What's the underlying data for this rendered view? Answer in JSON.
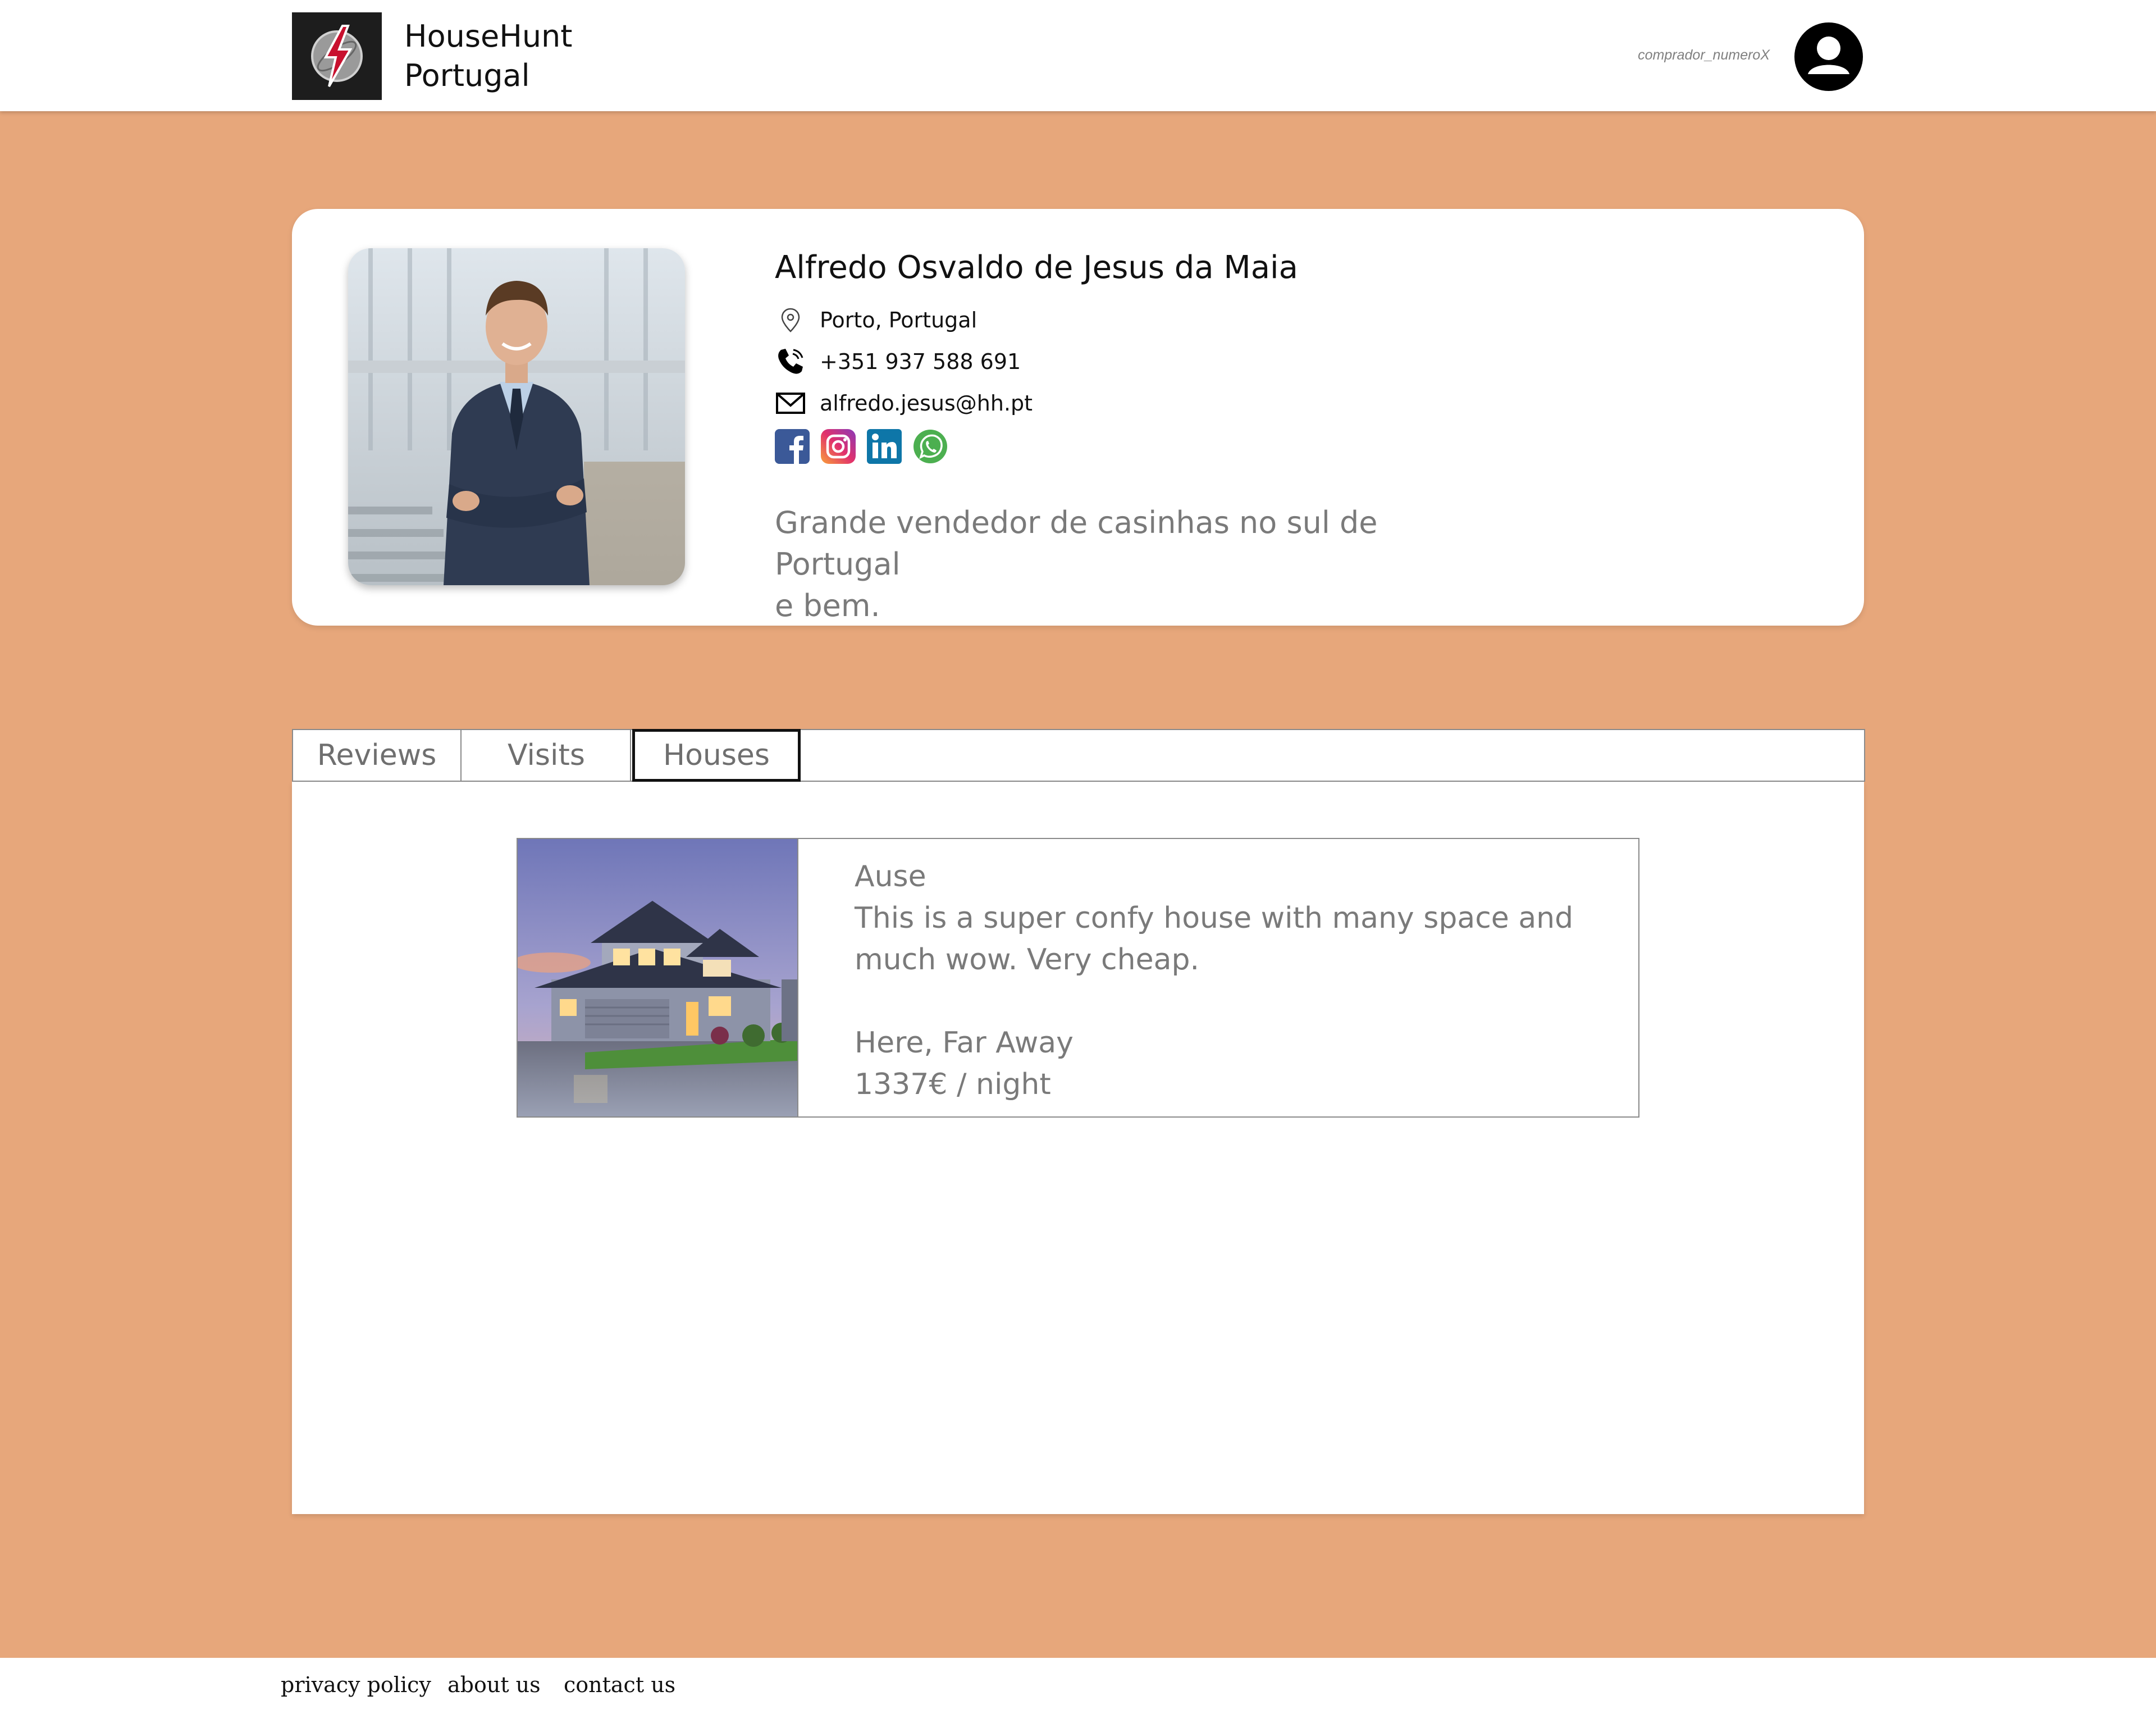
{
  "header": {
    "brand_line1": "HouseHunt",
    "brand_line2": "Portugal",
    "username": "comprador_numeroX",
    "logo_icon": "lightning-bolt-logo",
    "avatar_icon": "user-avatar-icon"
  },
  "profile": {
    "name": "Alfredo Osvaldo de Jesus da Maia",
    "location": "Porto, Portugal",
    "phone": "+351 937 588 691",
    "email": "alfredo.jesus@hh.pt",
    "bio_line1": "Grande vendedor de casinhas no sul de Portugal",
    "bio_line2": "e bem.",
    "socials": [
      "facebook-icon",
      "instagram-icon",
      "linkedin-icon",
      "whatsapp-icon"
    ]
  },
  "tabs": [
    {
      "label": "Reviews",
      "active": false
    },
    {
      "label": "Visits",
      "active": false
    },
    {
      "label": "Houses",
      "active": true
    }
  ],
  "house": {
    "title": "Ause",
    "description": "This is a super confy house with many space and much wow. Very cheap.",
    "location": "Here, Far Away",
    "price": "1337€ / night"
  },
  "footer": {
    "privacy": "privacy policy",
    "about": "about us",
    "contact": "contact us"
  },
  "colors": {
    "background": "#e7a77b",
    "card": "#ffffff",
    "muted_text": "#7a7a7a"
  }
}
